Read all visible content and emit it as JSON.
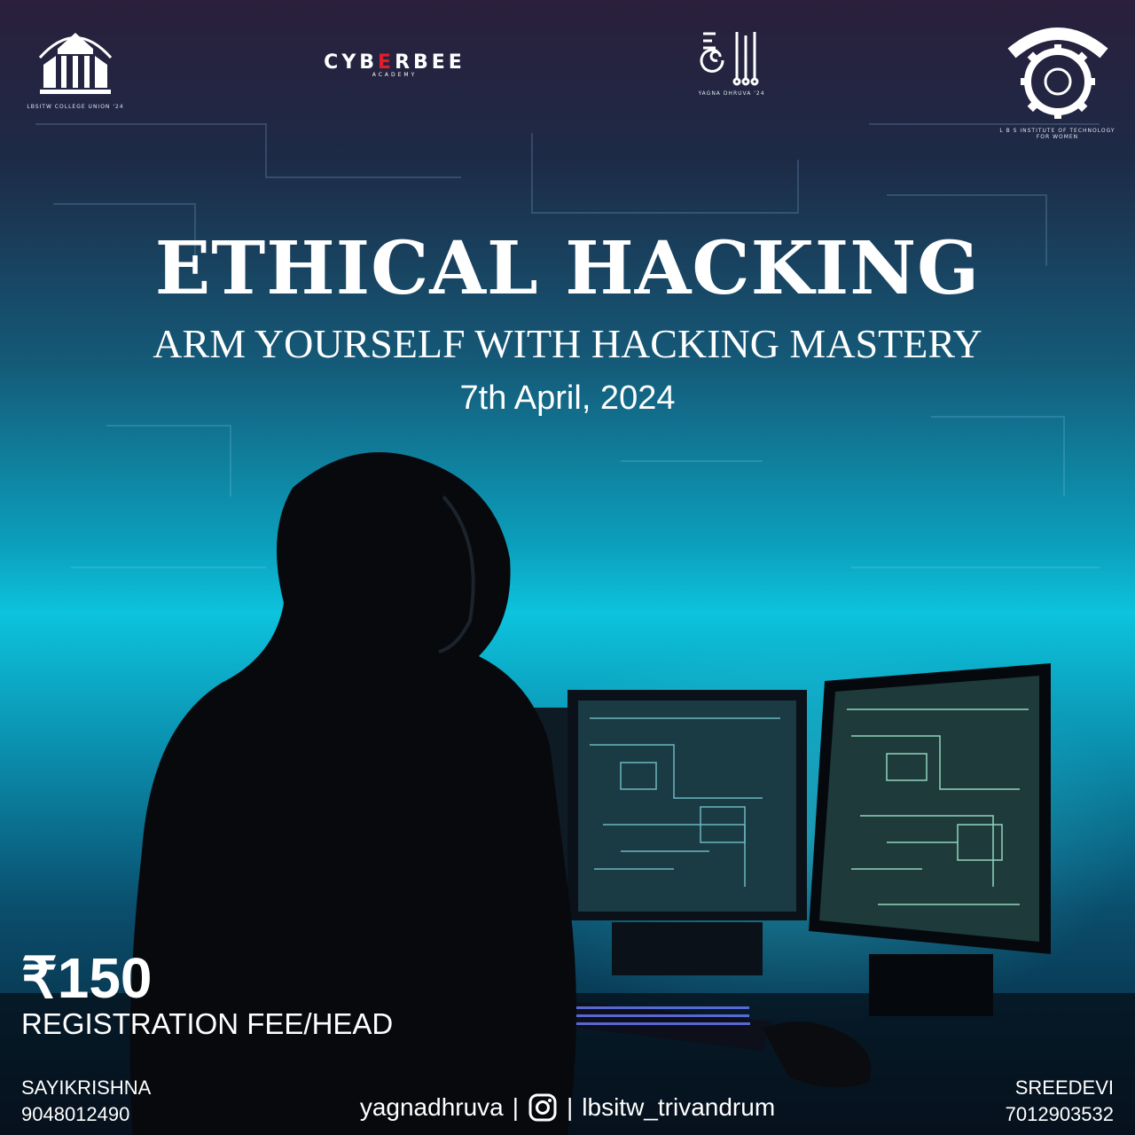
{
  "logos": {
    "union_caption": "LBSITW COLLEGE UNION '24",
    "cyberbee_part1": "CYB",
    "cyberbee_part2": "E",
    "cyberbee_part3": "RBEE",
    "cyberbee_sub": "ACADEMY",
    "yagna_caption": "YAGNA DHRUVA '24",
    "lbs_caption": "L B S INSTITUTE OF TECHNOLOGY FOR WOMEN"
  },
  "event": {
    "title": "ETHICAL HACKING",
    "tagline": "ARM YOURSELF WITH HACKING MASTERY",
    "date": "7th April, 2024"
  },
  "fee": {
    "amount": "₹150",
    "label": "REGISTRATION FEE/HEAD"
  },
  "contacts": {
    "left_name": "SAYIKRISHNA",
    "left_phone": "9048012490",
    "right_name": "SREEDEVI",
    "right_phone": "7012903532"
  },
  "social": {
    "handle_left": "yagnadhruva",
    "separator": "|",
    "icon": "instagram-icon",
    "handle_right": "lbsitw_trivandrum"
  },
  "colors": {
    "accent_cyan": "#0dc3dd",
    "brand_red": "#e11d2c"
  }
}
